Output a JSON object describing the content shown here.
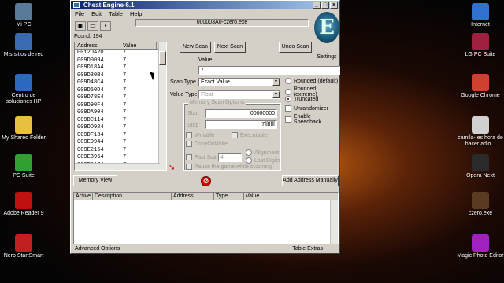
{
  "desktop": {
    "left_icons": [
      {
        "label": "Mi PC",
        "icon": "computer-icon",
        "color": "#5a7a9a"
      },
      {
        "label": "Mis sitios de red",
        "icon": "network-icon",
        "color": "#3a6ab0"
      },
      {
        "label": "Centro de soluciones HP",
        "icon": "hp-icon",
        "color": "#2a6ac0"
      },
      {
        "label": "My Shared Folder",
        "icon": "folder-icon",
        "color": "#e8c040"
      },
      {
        "label": "PC Suite",
        "icon": "pc-suite-icon",
        "color": "#30a030"
      },
      {
        "label": "Adobe Reader 9",
        "icon": "adobe-reader-icon",
        "color": "#c01010"
      },
      {
        "label": "Nero StartSmart",
        "icon": "nero-icon",
        "color": "#c02020"
      }
    ],
    "right_icons": [
      {
        "label": "Internet",
        "icon": "internet-icon",
        "color": "#3070d0"
      },
      {
        "label": "LG PC Suite",
        "icon": "lg-pc-suite-icon",
        "color": "#a02040"
      },
      {
        "label": "Google Chrome",
        "icon": "chrome-icon",
        "color": "#d04030"
      },
      {
        "label": "camila- es hora de hacer adio...",
        "icon": "media-file-icon",
        "color": "#d0d0d0"
      },
      {
        "label": "Opera Next",
        "icon": "opera-icon",
        "color": "#2a2a2a"
      },
      {
        "label": "czero.exe",
        "icon": "czero-icon",
        "color": "#5a3a20"
      },
      {
        "label": "Magic Photo Editor",
        "icon": "photo-editor-icon",
        "color": "#a020c0"
      }
    ]
  },
  "window": {
    "title": "Cheat Engine 6.1",
    "menu": [
      "File",
      "Edit",
      "Table",
      "Help"
    ],
    "process": "000003A0-czero.exe",
    "logo_label": "Settings",
    "found": "Found: 194",
    "list_headers": {
      "address": "Address",
      "value": "Value"
    },
    "rows": [
      {
        "address": "0012DA20",
        "value": "7"
      },
      {
        "address": "009D0094",
        "value": "7"
      },
      {
        "address": "009D18A4",
        "value": "7"
      },
      {
        "address": "009D30B4",
        "value": "7"
      },
      {
        "address": "009D48C4",
        "value": "7"
      },
      {
        "address": "009D60D4",
        "value": "7"
      },
      {
        "address": "009D78E4",
        "value": "7"
      },
      {
        "address": "009D90F4",
        "value": "7"
      },
      {
        "address": "009DA904",
        "value": "7"
      },
      {
        "address": "009DC114",
        "value": "7"
      },
      {
        "address": "009DD924",
        "value": "7"
      },
      {
        "address": "009DF134",
        "value": "7"
      },
      {
        "address": "009E0944",
        "value": "7"
      },
      {
        "address": "009E2154",
        "value": "7"
      },
      {
        "address": "009E3964",
        "value": "7"
      },
      {
        "address": "009E5174",
        "value": "7"
      },
      {
        "address": "009E6984",
        "value": "7"
      }
    ],
    "buttons": {
      "new_scan": "New Scan",
      "next_scan": "Next Scan",
      "undo_scan": "Undo Scan",
      "memory_view": "Memory View",
      "add_address": "Add Address Manually"
    },
    "value_label": "Value:",
    "value_input": "7",
    "scan_type_label": "Scan Type",
    "scan_type": "Exact Value",
    "value_type_label": "Value Type",
    "value_type": "Float",
    "rounding": {
      "options": [
        "Rounded (default)",
        "Rounded (extreme)",
        "Truncated"
      ],
      "selected": "Truncated"
    },
    "checks": {
      "unrandomizer": "Unrandomizer",
      "speedhack": "Enable Speedhack"
    },
    "memory_scan": {
      "title": "Memory Scan Options",
      "start_label": "Start",
      "start": "00000000",
      "stop_label": "Stop",
      "stop": "7fffffff",
      "writable": "Writable",
      "executable": "Executable",
      "copyonwrite": "CopyOnWrite",
      "fastscan": "Fast Scan",
      "fastscan_value": "4",
      "alignment": "Alignment",
      "last_digits": "Last Digits",
      "pause": "Pause the game while scanning"
    },
    "lower_headers": [
      "Active",
      "Description",
      "Address",
      "Type",
      "Value"
    ],
    "status_left": "Advanced Options",
    "status_right": "Table Extras"
  }
}
